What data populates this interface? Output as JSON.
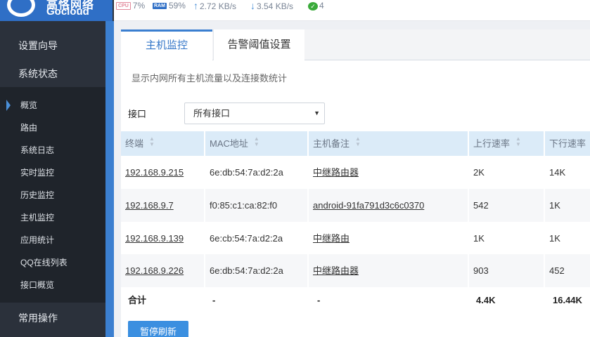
{
  "brand": {
    "name_cn": "高恪网络",
    "name_en": "Gocloud"
  },
  "status": {
    "cpu_badge": "CPU",
    "cpu": "7%",
    "ram_badge": "RAM",
    "ram": "59%",
    "upload": "2.72 KB/s",
    "download": "3.54 KB/s",
    "connections": "4"
  },
  "sidebar": {
    "sections": [
      "设置向导",
      "系统状态",
      "常用操作"
    ],
    "items": [
      "概览",
      "路由",
      "系统日志",
      "实时监控",
      "历史监控",
      "主机监控",
      "应用统计",
      "QQ在线列表",
      "接口概览"
    ],
    "active_item": "概览"
  },
  "tabs": [
    "主机监控",
    "告警阈值设置"
  ],
  "description": "显示内网所有主机流量以及连接数统计",
  "filter": {
    "label": "接口",
    "selected": "所有接口"
  },
  "table": {
    "columns": [
      "终端",
      "MAC地址",
      "主机备注",
      "上行速率",
      "下行速率"
    ],
    "rows": [
      {
        "ip": "192.168.9.215",
        "mac": "6e:db:54:7a:d2:2a",
        "note": "中继路由器",
        "up": "2K",
        "down": "14K"
      },
      {
        "ip": "192.168.9.7",
        "mac": "f0:85:c1:ca:82:f0",
        "note": "android-91fa791d3c6c0370",
        "up": "542",
        "down": "1K"
      },
      {
        "ip": "192.168.9.139",
        "mac": "6e:cb:54:7a:d2:2a",
        "note": "中继路由",
        "up": "1K",
        "down": "1K"
      },
      {
        "ip": "192.168.9.226",
        "mac": "6e:db:54:7a:d2:2a",
        "note": "中继路由器",
        "up": "903",
        "down": "452"
      }
    ],
    "total": {
      "label": "合计",
      "mac": "-",
      "note": "-",
      "up": "4.4K",
      "down": "16.44K"
    }
  },
  "pause_button": "暂停刷新"
}
